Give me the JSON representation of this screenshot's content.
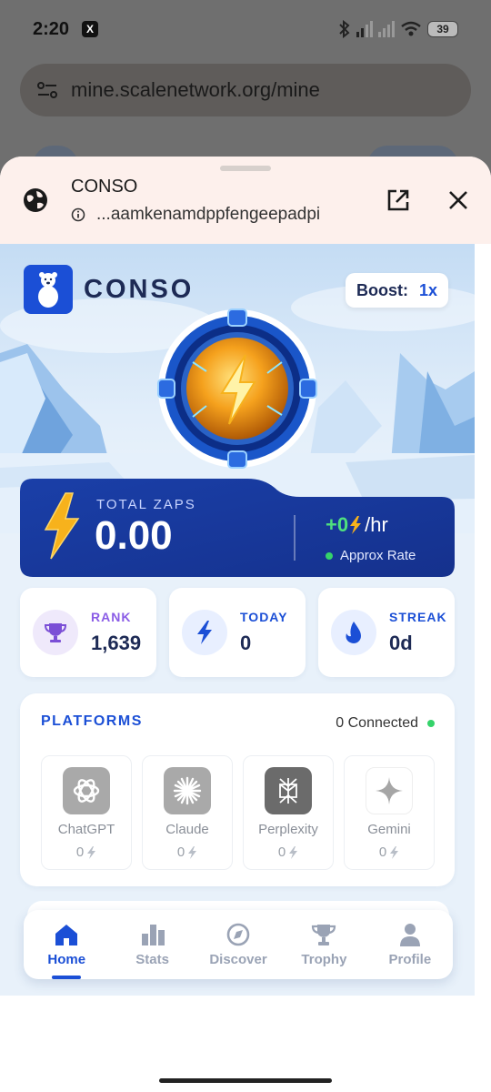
{
  "status_bar": {
    "time": "2:20",
    "battery": "39"
  },
  "browser": {
    "url": "mine.scalenetwork.org/mine"
  },
  "sheet": {
    "title": "CONSO",
    "url": "...aamkenamdppfengeepadpi"
  },
  "app": {
    "brand": "CONSO",
    "boost": {
      "label": "Boost:",
      "value": "1x"
    },
    "total_zaps": {
      "label": "TOTAL ZAPS",
      "value": "0.00",
      "rate_value": "+0",
      "rate_unit": "/hr",
      "rate_caption": "Approx Rate"
    },
    "stats": [
      {
        "label": "RANK",
        "value": "1,639",
        "color": "#8a5ce6",
        "icon": "trophy-icon"
      },
      {
        "label": "TODAY",
        "value": "0",
        "color": "#1b4fd6",
        "icon": "bolt-icon"
      },
      {
        "label": "STREAK",
        "value": "0d",
        "color": "#1b4fd6",
        "icon": "flame-icon"
      }
    ],
    "platforms": {
      "title": "PLATFORMS",
      "connected": "0 Connected",
      "items": [
        {
          "name": "ChatGPT",
          "score": "0"
        },
        {
          "name": "Claude",
          "score": "0"
        },
        {
          "name": "Perplexity",
          "score": "0"
        },
        {
          "name": "Gemini",
          "score": "0"
        }
      ]
    },
    "nav": [
      {
        "label": "Home",
        "active": true,
        "icon": "home-icon"
      },
      {
        "label": "Stats",
        "active": false,
        "icon": "stats-icon"
      },
      {
        "label": "Discover",
        "active": false,
        "icon": "compass-icon"
      },
      {
        "label": "Trophy",
        "active": false,
        "icon": "trophy-icon"
      },
      {
        "label": "Profile",
        "active": false,
        "icon": "profile-icon"
      }
    ]
  },
  "colors": {
    "primary": "#1b4fd6",
    "navy": "#1d2a55",
    "accent_green": "#4fe07e",
    "bolt": "#f7b21c"
  }
}
